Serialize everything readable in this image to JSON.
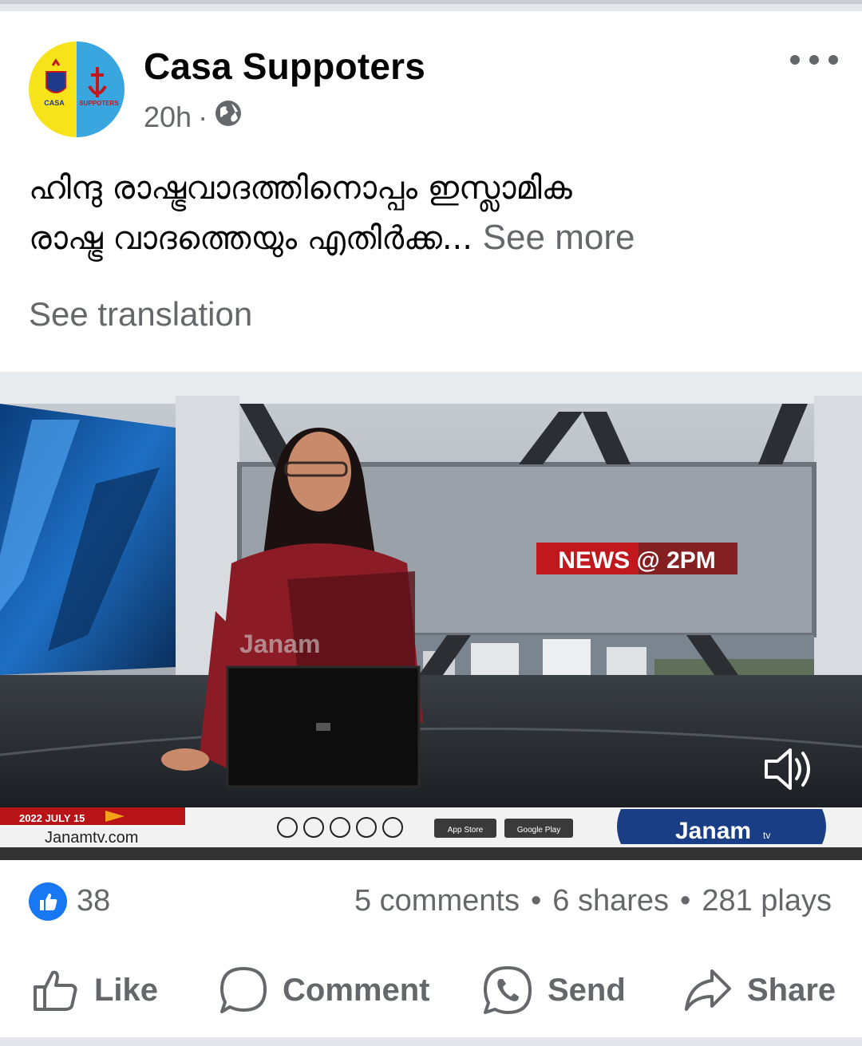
{
  "post": {
    "page_name": "Casa Suppoters",
    "time": "20h",
    "separator": "·",
    "avatar_left_text": "CASA",
    "avatar_right_text": "SUPPOTERS",
    "text_line1": "ഹിന്ദു രാഷ്ട്രവാദത്തിനൊപ്പം ഇസ്ലാമിക",
    "text_line2": "രാഷ്ട്ര വാദത്തെയും എതിർക്ക...",
    "see_more": "See more",
    "see_translation": "See translation"
  },
  "video": {
    "studio_logo": "Janam",
    "news_badge": "NEWS @ 2PM",
    "date_ticker": "2022 JULY 15",
    "website": "Janamtv.com",
    "channel_brand": "Janam",
    "channel_sub": "tv",
    "app_store": "App Store",
    "google_play": "Google Play"
  },
  "stats": {
    "likes": "38",
    "comments": "5 comments",
    "shares": "6 shares",
    "plays": "281 plays",
    "dot": "•"
  },
  "actions": {
    "like": "Like",
    "comment": "Comment",
    "send": "Send",
    "share": "Share"
  },
  "colors": {
    "brand_blue": "#1877f2",
    "secondary_text": "#65676b",
    "badge_red": "#c0181d",
    "avatar_yellow": "#f7e319",
    "avatar_blue": "#3aa6e0"
  }
}
